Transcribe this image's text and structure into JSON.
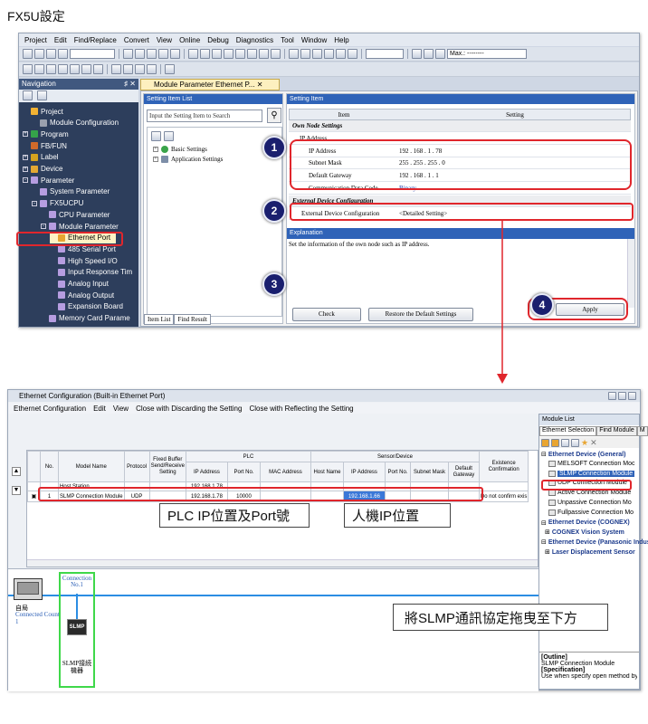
{
  "top_title": "FX5U設定",
  "gx": {
    "menu": [
      "Project",
      "Edit",
      "Find/Replace",
      "Convert",
      "View",
      "Online",
      "Debug",
      "Diagnostics",
      "Tool",
      "Window",
      "Help"
    ],
    "toolbar_zoom_label": "Max.: --------",
    "navigation_title": "Navigation",
    "navigation_pin": "♯ ✕",
    "nav_items": [
      {
        "label": "Project",
        "level": 0,
        "icon": "folder-icon",
        "color": "#f2b233",
        "exp": "",
        "sel": false
      },
      {
        "label": "Module Configuration",
        "level": 1,
        "icon": "module-config-icon",
        "color": "#9aa0ad",
        "exp": "",
        "sel": false
      },
      {
        "label": "Program",
        "level": 0,
        "icon": "program-icon",
        "color": "#35a34a",
        "exp": "+",
        "sel": false
      },
      {
        "label": "FB/FUN",
        "level": 0,
        "icon": "fb-fun-icon",
        "color": "#d06a2a",
        "exp": "",
        "sel": false
      },
      {
        "label": "Label",
        "level": 0,
        "icon": "label-icon",
        "color": "#d4a21e",
        "exp": "+",
        "sel": false
      },
      {
        "label": "Device",
        "level": 0,
        "icon": "device-icon",
        "color": "#e3a833",
        "exp": "+",
        "sel": false
      },
      {
        "label": "Parameter",
        "level": 0,
        "icon": "parameter-icon",
        "color": "#b69de0",
        "exp": "-",
        "sel": false
      },
      {
        "label": "System Parameter",
        "level": 1,
        "icon": "system-parameter-icon",
        "color": "#b69de0",
        "exp": "",
        "sel": false
      },
      {
        "label": "FX5UCPU",
        "level": 1,
        "icon": "cpu-icon",
        "color": "#b69de0",
        "exp": "-",
        "sel": false
      },
      {
        "label": "CPU Parameter",
        "level": 2,
        "icon": "cpu-parameter-icon",
        "color": "#b69de0",
        "exp": "",
        "sel": false
      },
      {
        "label": "Module Parameter",
        "level": 2,
        "icon": "module-parameter-icon",
        "color": "#b69de0",
        "exp": "-",
        "sel": false
      },
      {
        "label": "Ethernet Port",
        "level": 3,
        "icon": "ethernet-port-icon",
        "color": "#e8a531",
        "exp": "",
        "sel": true
      },
      {
        "label": "485 Serial Port",
        "level": 3,
        "icon": "serial-port-icon",
        "color": "#b69de0",
        "exp": "",
        "sel": false
      },
      {
        "label": "High Speed I/O",
        "level": 3,
        "icon": "high-speed-io-icon",
        "color": "#b69de0",
        "exp": "",
        "sel": false
      },
      {
        "label": "Input Response Tim",
        "level": 3,
        "icon": "input-response-icon",
        "color": "#b69de0",
        "exp": "",
        "sel": false
      },
      {
        "label": "Analog Input",
        "level": 3,
        "icon": "analog-input-icon",
        "color": "#b69de0",
        "exp": "",
        "sel": false
      },
      {
        "label": "Analog Output",
        "level": 3,
        "icon": "analog-output-icon",
        "color": "#b69de0",
        "exp": "",
        "sel": false
      },
      {
        "label": "Expansion Board",
        "level": 3,
        "icon": "expansion-board-icon",
        "color": "#b69de0",
        "exp": "",
        "sel": false
      },
      {
        "label": "Memory Card Parame",
        "level": 2,
        "icon": "memory-card-icon",
        "color": "#b69de0",
        "exp": "",
        "sel": false
      }
    ],
    "doc_tab": "Module Parameter Ethernet P... ✕",
    "setting_item_list_title": "Setting Item List",
    "search_placeholder": "Input the Setting Item to Search",
    "tree_items": [
      "Basic Settings",
      "Application Settings"
    ],
    "left_tabs": [
      "Item List",
      "Find Result"
    ],
    "setting_item_title": "Setting Item",
    "table_header": {
      "item": "Item",
      "setting": "Setting"
    },
    "rows": [
      {
        "item": "Own Node Settings",
        "value": "",
        "type": "section"
      },
      {
        "item": "IP Address",
        "value": "",
        "type": "group"
      },
      {
        "item": "IP Address",
        "value": "192 . 168 . 1 . 78",
        "type": "field"
      },
      {
        "item": "Subnet Mask",
        "value": "255 . 255 . 255 . 0",
        "type": "field"
      },
      {
        "item": "Default Gateway",
        "value": "192 . 168 . 1 . 1",
        "type": "field"
      },
      {
        "item": "Communication Data Code",
        "value": "Binary",
        "type": "field-blue"
      },
      {
        "item": "External Device Configuration",
        "value": "",
        "type": "section"
      },
      {
        "item": "External Device Configuration",
        "value": "<Detailed Setting>",
        "type": "field"
      }
    ],
    "explanation_title": "Explanation",
    "explanation_text": "Set the information of the own node such as IP address.",
    "check_label": "Check",
    "restore_label": "Restore the Default Settings",
    "apply_label": "Apply"
  },
  "badges": [
    "1",
    "2",
    "3",
    "4"
  ],
  "ec": {
    "title": "Ethernet Configuration (Built-in Ethernet Port)",
    "menu": [
      "Ethernet Configuration",
      "Edit",
      "View",
      "Close with Discarding the Setting",
      "Close with Reflecting the Setting"
    ],
    "headers": {
      "no": "No.",
      "model": "Model Name",
      "protocol": "Protocol",
      "fixed_buffer": "Fixed Buffer Send/Receive Setting",
      "plc": "PLC",
      "sensor": "Sensor/Device",
      "ip": "IP Address",
      "port": "Port No.",
      "mac": "MAC Address",
      "host": "Host Name",
      "subnet": "Subnet Mask",
      "gateway": "Default Gateway",
      "existence": "Existence Confirmation"
    },
    "host_row": {
      "model": "Host Station",
      "plc_ip": "192.168.1.78"
    },
    "row1": {
      "no": "1",
      "model": "SLMP Connection Module",
      "protocol": "UDP",
      "plc_ip": "192.168.1.78",
      "plc_port": "10000",
      "sensor_ip": "192.168.1.66",
      "existence": "Do not confirm exis"
    },
    "module_list_title": "Module List",
    "module_tabs": [
      "Ethernet Selection",
      "Find Module",
      "M"
    ],
    "module_groups": [
      {
        "label": "Ethernet Device (General)",
        "kind": "head"
      },
      {
        "label": "MELSOFT Connection Moc",
        "kind": "item"
      },
      {
        "label": "SLMP Connection Module",
        "kind": "selected"
      },
      {
        "label": "UDP Connection Module",
        "kind": "item"
      },
      {
        "label": "Active Connection Module",
        "kind": "item"
      },
      {
        "label": "Unpassive Connection Mo",
        "kind": "item"
      },
      {
        "label": "Fullpassive Connection Mo",
        "kind": "item"
      },
      {
        "label": "Ethernet Device (COGNEX)",
        "kind": "head"
      },
      {
        "label": "COGNEX Vision System",
        "kind": "sub"
      },
      {
        "label": "Ethernet Device (Panasonic Indus",
        "kind": "head"
      },
      {
        "label": "Laser Displacement Sensor",
        "kind": "sub"
      }
    ],
    "outline_head": "[Outline]",
    "outline_text": "SLMP Connection Module",
    "spec_head": "[Specification]",
    "spec_text": "Use when specify open method by SLMP",
    "connection_label": "Connection No.1",
    "host_station_label": "自局",
    "connected_count": "Connected Count 1",
    "slmp_icon": "SLMP",
    "slmp_device_label": "SLMP接続機器"
  },
  "captions": {
    "plc_ip_port": "PLC IP位置及Port號",
    "hmi_ip": "人機IP位置",
    "drag_slmp": "將SLMP通訊協定拖曳至下方"
  },
  "colors": {
    "accent_red": "#e0262c",
    "nav_bg": "#2d3e5c",
    "badge": "#1a1f6e",
    "line_blue": "#2b8de3",
    "green_frame": "#3fd84a"
  }
}
